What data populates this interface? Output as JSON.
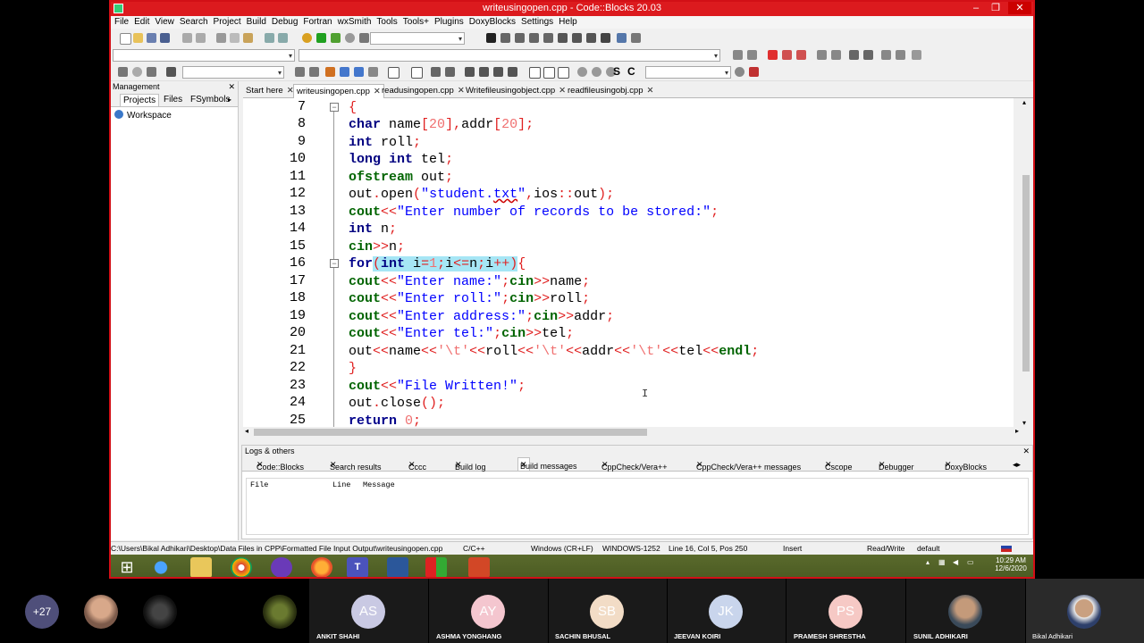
{
  "window": {
    "title": "writeusingopen.cpp - Code::Blocks 20.03"
  },
  "menu": [
    "File",
    "Edit",
    "View",
    "Search",
    "Project",
    "Build",
    "Debug",
    "Fortran",
    "wxSmith",
    "Tools",
    "Tools+",
    "Plugins",
    "DoxyBlocks",
    "Settings",
    "Help"
  ],
  "management": {
    "title": "Management",
    "tabs": [
      "Projects",
      "Files",
      "FSymbols"
    ],
    "workspace": "Workspace"
  },
  "editor_tabs": [
    "Start here",
    "writeusingopen.cpp",
    "readusingopen.cpp",
    "Writefileusingobject.cpp",
    "readfileusingobj.cpp"
  ],
  "line_numbers": [
    "7",
    "8",
    "9",
    "10",
    "11",
    "12",
    "13",
    "14",
    "15",
    "16",
    "17",
    "18",
    "19",
    "20",
    "21",
    "22",
    "23",
    "24",
    "25"
  ],
  "logs": {
    "title": "Logs & others",
    "tabs": [
      "Code::Blocks",
      "Search results",
      "Cccc",
      "Build log",
      "Build messages",
      "CppCheck/Vera++",
      "CppCheck/Vera++ messages",
      "Cscope",
      "Debugger",
      "DoxyBlocks"
    ],
    "columns": [
      "File",
      "Line",
      "Message"
    ]
  },
  "status": {
    "path": "C:\\Users\\Bikal Adhikari\\Desktop\\Data Files in CPP\\Formatted File Input Output\\writeusingopen.cpp",
    "lang": "C/C++",
    "eol": "Windows (CR+LF)",
    "encoding": "WINDOWS-1252",
    "position": "Line 16, Col 5, Pos 250",
    "mode": "Insert",
    "rw": "Read/Write",
    "profile": "default"
  },
  "clock": {
    "time": "10:29 AM",
    "date": "12/6/2020"
  },
  "participants": {
    "more": "+27",
    "people": [
      {
        "initials": "AS",
        "name": "ANKIT SHAHI",
        "color": "#c9c9e3"
      },
      {
        "initials": "AY",
        "name": "ASHMA YONGHANG",
        "color": "#f4c6cf"
      },
      {
        "initials": "SB",
        "name": "SACHIN BHUSAL",
        "color": "#f2dcc6"
      },
      {
        "initials": "JK",
        "name": "JEEVAN KOIRI",
        "color": "#c9d5ec"
      },
      {
        "initials": "PS",
        "name": "PRAMESH SHRESTHA",
        "color": "#f6c9c5"
      }
    ],
    "photo_names": [
      "SUNIL ADHIKARI",
      "Bikal Adhikari"
    ]
  },
  "colors": {
    "titlebar": "#dc1a1e",
    "highlight": "#a6e6f5",
    "keyword": "#00008b",
    "string": "#0000ff",
    "number": "#f07070"
  }
}
